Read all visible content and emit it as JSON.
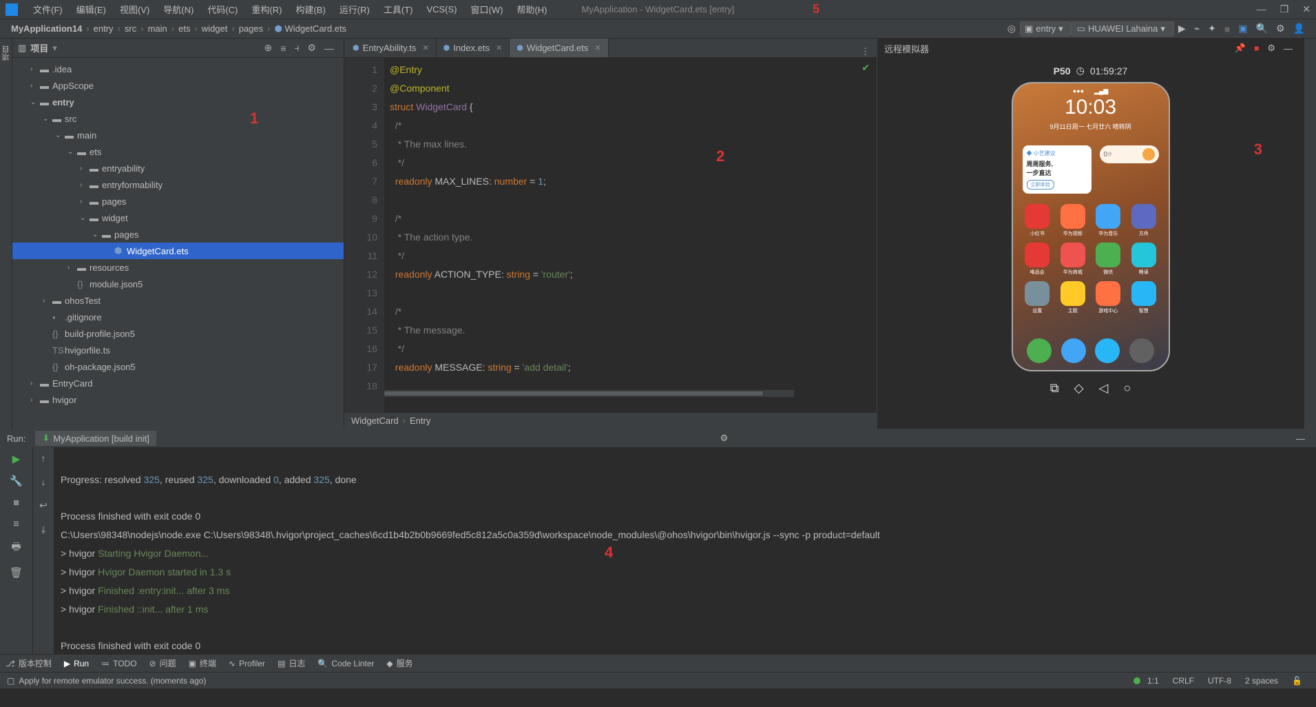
{
  "window": {
    "title": "MyApplication - WidgetCard.ets [entry]"
  },
  "menu": [
    "文件(F)",
    "编辑(E)",
    "视图(V)",
    "导航(N)",
    "代码(C)",
    "重构(R)",
    "构建(B)",
    "运行(R)",
    "工具(T)",
    "VCS(S)",
    "窗口(W)",
    "帮助(H)"
  ],
  "breadcrumbs": [
    "MyApplication14",
    "entry",
    "src",
    "main",
    "ets",
    "widget",
    "pages",
    "WidgetCard.ets"
  ],
  "toolbar": {
    "run_config": "entry",
    "device": "HUAWEI Lahaina"
  },
  "projectPanel": {
    "title": "项目"
  },
  "tree": [
    {
      "indent": 1,
      "chev": "›",
      "icon": "folder",
      "label": ".idea"
    },
    {
      "indent": 1,
      "chev": "›",
      "icon": "folder",
      "label": "AppScope"
    },
    {
      "indent": 1,
      "chev": "⌄",
      "icon": "folder",
      "label": "entry",
      "bold": true
    },
    {
      "indent": 2,
      "chev": "⌄",
      "icon": "folder",
      "label": "src"
    },
    {
      "indent": 3,
      "chev": "⌄",
      "icon": "folder",
      "label": "main"
    },
    {
      "indent": 4,
      "chev": "⌄",
      "icon": "folder",
      "label": "ets"
    },
    {
      "indent": 5,
      "chev": "›",
      "icon": "folder",
      "label": "entryability"
    },
    {
      "indent": 5,
      "chev": "›",
      "icon": "folder",
      "label": "entryformability"
    },
    {
      "indent": 5,
      "chev": "›",
      "icon": "folder",
      "label": "pages"
    },
    {
      "indent": 5,
      "chev": "⌄",
      "icon": "folder",
      "label": "widget"
    },
    {
      "indent": 6,
      "chev": "⌄",
      "icon": "folder",
      "label": "pages"
    },
    {
      "indent": 7,
      "chev": "",
      "icon": "ets",
      "label": "WidgetCard.ets",
      "selected": true
    },
    {
      "indent": 4,
      "chev": "›",
      "icon": "folder",
      "label": "resources"
    },
    {
      "indent": 4,
      "chev": "",
      "icon": "json",
      "label": "module.json5"
    },
    {
      "indent": 2,
      "chev": "›",
      "icon": "folder",
      "label": "ohosTest"
    },
    {
      "indent": 2,
      "chev": "",
      "icon": "file",
      "label": ".gitignore"
    },
    {
      "indent": 2,
      "chev": "",
      "icon": "json",
      "label": "build-profile.json5"
    },
    {
      "indent": 2,
      "chev": "",
      "icon": "ts",
      "label": "hvigorfile.ts"
    },
    {
      "indent": 2,
      "chev": "",
      "icon": "json",
      "label": "oh-package.json5"
    },
    {
      "indent": 1,
      "chev": "›",
      "icon": "folder",
      "label": "EntryCard"
    },
    {
      "indent": 1,
      "chev": "›",
      "icon": "folder",
      "label": "hvigor"
    }
  ],
  "editor": {
    "tabs": [
      {
        "label": "EntryAbility.ts",
        "active": false
      },
      {
        "label": "Index.ets",
        "active": false
      },
      {
        "label": "WidgetCard.ets",
        "active": true
      }
    ],
    "crumbs": [
      "WidgetCard",
      "Entry"
    ],
    "code_lines": {
      "n1": "1",
      "n2": "2",
      "n3": "3",
      "n4": "4",
      "n5": "5",
      "n6": "6",
      "n7": "7",
      "n8": "8",
      "n9": "9",
      "n10": "10",
      "n11": "11",
      "n12": "12",
      "n13": "13",
      "n14": "14",
      "n15": "15",
      "n16": "16",
      "n17": "17",
      "n18": "18"
    },
    "code": {
      "l1_anno": "@Entry",
      "l2_anno": "@Component",
      "l3_kw": "struct",
      "l3_name": "WidgetCard",
      "l3_brace": " {",
      "l4": "  /*",
      "l5": "   * The max lines.",
      "l6": "   */",
      "l7_kw": "  readonly ",
      "l7_name": "MAX_LINES",
      "l7_colon": ": ",
      "l7_type": "number",
      "l7_eq": " = ",
      "l7_val": "1",
      "l7_semi": ";",
      "l9": "  /*",
      "l10": "   * The action type.",
      "l11": "   */",
      "l12_kw": "  readonly ",
      "l12_name": "ACTION_TYPE",
      "l12_colon": ": ",
      "l12_type": "string",
      "l12_eq": " = ",
      "l12_val": "'router'",
      "l12_semi": ";",
      "l14": "  /*",
      "l15": "   * The message.",
      "l16": "   */",
      "l17_kw": "  readonly ",
      "l17_name": "MESSAGE",
      "l17_colon": ": ",
      "l17_type": "string",
      "l17_eq": " = ",
      "l17_val": "'add detail'",
      "l17_semi": ";"
    }
  },
  "emulator": {
    "title": "远程模拟器",
    "device": "P50",
    "timer": "01:59:27",
    "phone_clock": "10:03",
    "phone_date": "9月11日周一 七月廿六 晴转阴",
    "widget_title": "小艺建议",
    "widget_line1": "周周服务,",
    "widget_line2": "一步直达",
    "widget_btn": "立即体验",
    "pill_val": "0",
    "apps": [
      {
        "label": "小红书",
        "color": "#e53935"
      },
      {
        "label": "华为视频",
        "color": "#ff7043"
      },
      {
        "label": "华为音乐",
        "color": "#42a5f5"
      },
      {
        "label": "方舟",
        "color": "#5c6bc0"
      },
      {
        "label": "唯品会",
        "color": "#e53935"
      },
      {
        "label": "华为商城",
        "color": "#ef5350"
      },
      {
        "label": "微信",
        "color": "#4caf50"
      },
      {
        "label": "畅读",
        "color": "#26c6da"
      },
      {
        "label": "设置",
        "color": "#78909c"
      },
      {
        "label": "主题",
        "color": "#ffca28"
      },
      {
        "label": "游戏中心",
        "color": "#ff7043"
      },
      {
        "label": "智慧",
        "color": "#29b6f6"
      }
    ],
    "dock": [
      {
        "color": "#4caf50"
      },
      {
        "color": "#42a5f5"
      },
      {
        "color": "#29b6f6"
      },
      {
        "color": "#616161"
      }
    ]
  },
  "runPanel": {
    "label_run": "Run:",
    "tab": "MyApplication [build init]",
    "lines": {
      "l1a": "Progress: resolved ",
      "l1b": "325",
      "l1c": ", reused ",
      "l1d": "325",
      "l1e": ", downloaded ",
      "l1f": "0",
      "l1g": ", added ",
      "l1h": "325",
      "l1i": ", done",
      "l3": "Process finished with exit code 0",
      "l4": "C:\\Users\\98348\\nodejs\\node.exe C:\\Users\\98348\\.hvigor\\project_caches\\6cd1b4b2b0b9669fed5c812a5c0a359d\\workspace\\node_modules\\@ohos\\hvigor\\bin\\hvigor.js --sync -p product=default",
      "l5a": "> hvigor ",
      "l5b": "Starting Hvigor Daemon...",
      "l6a": "> hvigor ",
      "l6b": "Hvigor Daemon started in 1.3 s",
      "l7a": "> hvigor ",
      "l7b": "Finished :entry:init... after 3 ms",
      "l8a": "> hvigor ",
      "l8b": "Finished ::init... after 1 ms",
      "l10": "Process finished with exit code 0"
    }
  },
  "bottomTools": {
    "vcs": "版本控制",
    "run": "Run",
    "todo": "TODO",
    "problems": "问题",
    "terminal": "终端",
    "profiler": "Profiler",
    "log": "日志",
    "codeLinter": "Code Linter",
    "services": "服务"
  },
  "status": {
    "msg": "Apply for remote emulator success. (moments ago)",
    "pos": "1:1",
    "eol": "CRLF",
    "enc": "UTF-8",
    "indent": "2 spaces"
  },
  "annotations": {
    "a1": "1",
    "a2": "2",
    "a3": "3",
    "a4": "4",
    "a5": "5"
  }
}
